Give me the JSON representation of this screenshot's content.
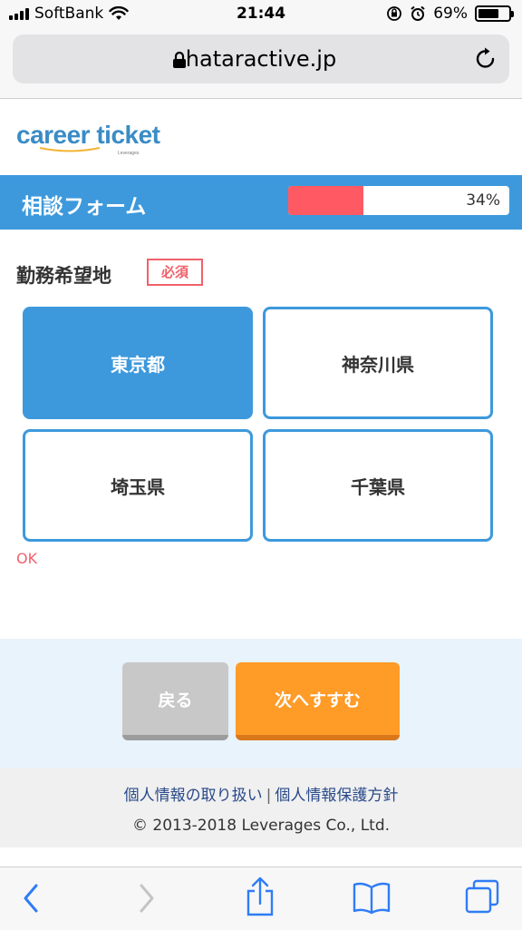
{
  "status_bar": {
    "carrier": "SoftBank",
    "time": "21:44",
    "battery_percent": "69%",
    "battery_level": 0.69
  },
  "browser": {
    "url": "hataractive.jp"
  },
  "logo": {
    "text": "career ticket",
    "sub": "Leverages"
  },
  "form_header": {
    "title": "相談フォーム",
    "progress_label": "34%",
    "progress_value": 0.34
  },
  "question": {
    "title": "勤務希望地",
    "required_badge": "必須",
    "options": [
      {
        "label": "東京都",
        "selected": true
      },
      {
        "label": "神奈川県",
        "selected": false
      },
      {
        "label": "埼玉県",
        "selected": false
      },
      {
        "label": "千葉県",
        "selected": false
      }
    ],
    "validation": "OK"
  },
  "navigation": {
    "back_label": "戻る",
    "next_label": "次へすすむ"
  },
  "footer": {
    "privacy_handling": "個人情報の取り扱い",
    "separator": "|",
    "privacy_policy": "個人情報保護方針",
    "copyright": "© 2013-2018 Leverages Co., Ltd."
  },
  "colors": {
    "accent": "#3d99dc",
    "progress": "#ff5a63",
    "next_button": "#ff9b27",
    "required": "#f0616a"
  },
  "toolbar_icons": [
    "back-arrow-icon",
    "forward-arrow-icon",
    "share-icon",
    "bookmarks-icon",
    "tabs-icon"
  ]
}
